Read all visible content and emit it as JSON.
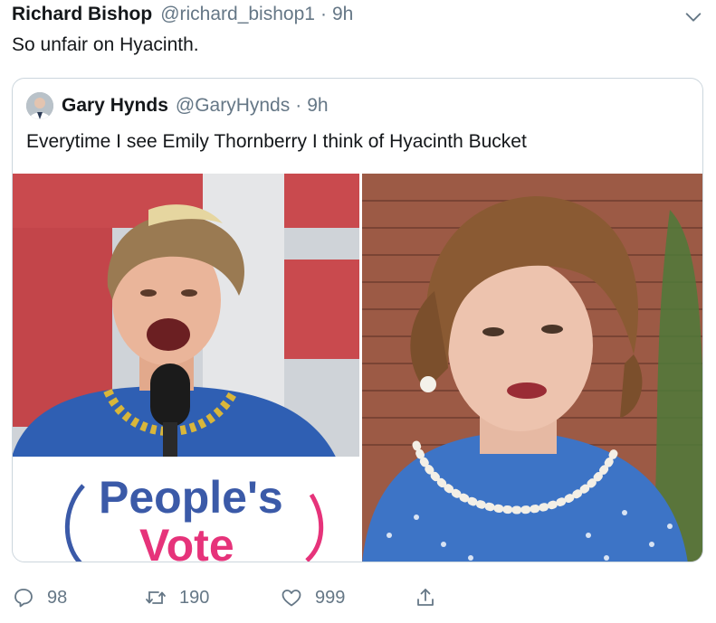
{
  "tweet": {
    "author_name": "Richard Bishop",
    "author_handle": "@richard_bishop1",
    "separator": "·",
    "time": "9h",
    "text": "So unfair on Hyacinth.",
    "menu_icon": "chevron-down-icon"
  },
  "quoted_tweet": {
    "author_name": "Gary Hynds",
    "author_handle": "@GaryHynds",
    "separator": "·",
    "time": "9h",
    "text": "Everytime I see Emily Thornberry I think of Hyacinth Bucket",
    "images": [
      {
        "name": "photo-left",
        "sign_line1": "People's",
        "sign_line2": "Vote"
      },
      {
        "name": "photo-right"
      }
    ]
  },
  "actions": {
    "replies": {
      "icon": "reply-icon",
      "count": "98"
    },
    "retweets": {
      "icon": "retweet-icon",
      "count": "190"
    },
    "likes": {
      "icon": "heart-icon",
      "count": "999"
    },
    "share": {
      "icon": "share-icon"
    }
  },
  "colors": {
    "text": "#14171a",
    "secondary": "#657786",
    "border": "#ccd6dd",
    "sign_text": "#3b5aa8",
    "sign_accent": "#e6337a"
  }
}
